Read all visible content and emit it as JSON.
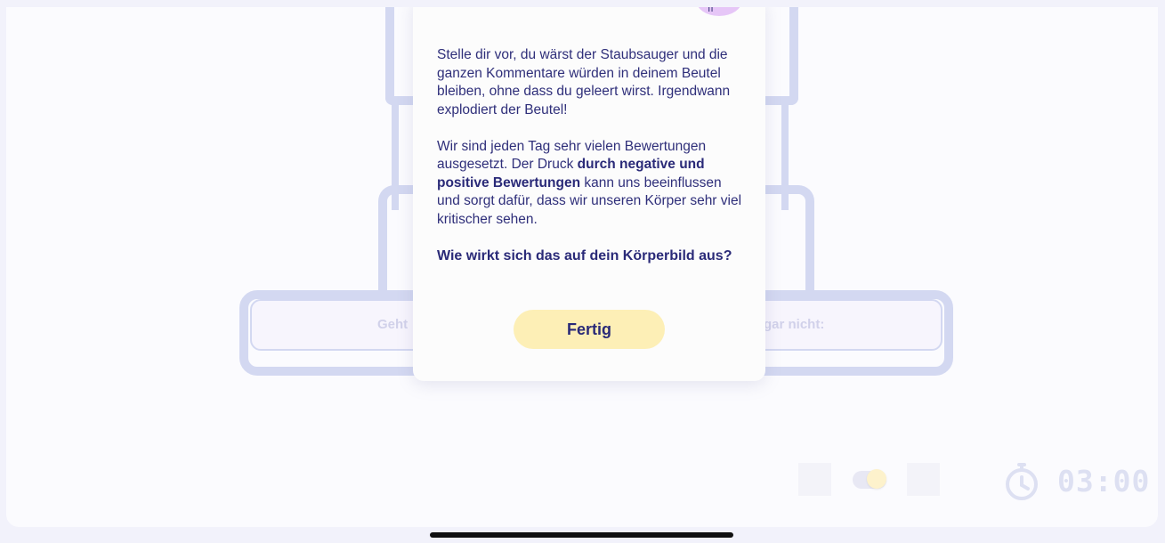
{
  "background": {
    "scale_left_label": "Geht",
    "scale_right_label": "gar nicht:"
  },
  "dialog": {
    "avatar_mark": "ıı",
    "paragraph1": "Stelle dir vor, du wärst der Staubsauger und die ganzen Kommentare würden in deinem Beutel bleiben, ohne dass du geleert wirst. Irgendwann explodiert der Beutel!",
    "paragraph2_pre": "Wir sind jeden Tag sehr vielen Bewertungen ausgesetzt. Der Druck ",
    "paragraph2_bold": "durch negative und positive Bewertungen",
    "paragraph2_post": " kann uns beeinflussen und sorgt dafür, dass wir unseren Körper sehr viel kritischer sehen.",
    "question": "Wie wirkt sich das auf dein Körperbild aus?",
    "done_label": "Fertig"
  },
  "controls": {
    "timer": "03:00",
    "toggle_on": true
  },
  "colors": {
    "text": "#2f2f7a",
    "button": "#fdefb6",
    "outline": "#d3d8f1"
  },
  "icons": [
    "timer-icon"
  ]
}
